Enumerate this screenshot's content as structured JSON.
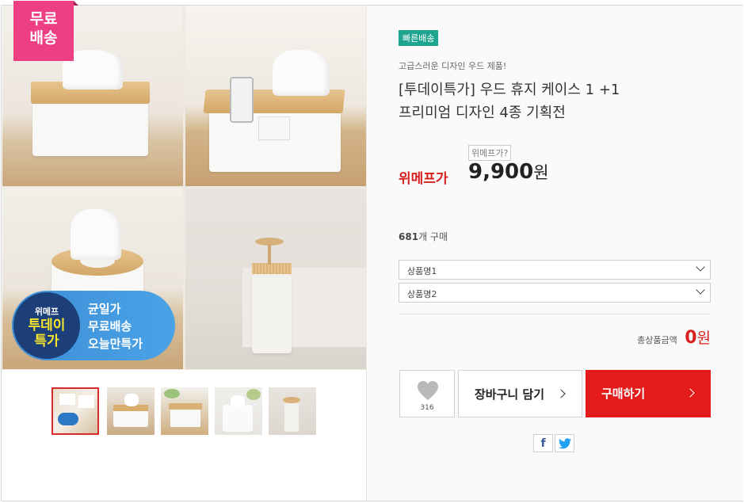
{
  "gallery": {
    "free_shipping_badge": [
      "무료",
      "배송"
    ],
    "promo": {
      "brand": "위메프",
      "title_lines": [
        "투데이",
        "특가"
      ],
      "lines": [
        "균일가",
        "무료배송",
        "오늘만특가"
      ]
    },
    "thumbnail_count": 5,
    "active_thumbnail": 1
  },
  "product": {
    "fast_badge": "빠른배송",
    "subtitle": "고급스러운 디자인 우드 제품!",
    "title_line1": "[투데이특가] 우드 휴지 케이스 1 +1",
    "title_line2": "프리미엄 디자인 4종 기획전",
    "price_question": "위메프가?",
    "price_label": "위메프가",
    "price": "9,900",
    "price_unit": "원",
    "sold_count": "681",
    "sold_suffix": "개 구매"
  },
  "options": {
    "select1": "상품명1",
    "select2": "상품명2"
  },
  "total": {
    "label": "총상품금액",
    "amount": "0",
    "unit": "원"
  },
  "actions": {
    "like_count": "316",
    "cart_label": "장바구니 담기",
    "buy_label": "구매하기"
  },
  "share": {
    "facebook_glyph": "f",
    "twitter_glyph": "t"
  },
  "colors": {
    "free_badge": "#ee3e84",
    "fast_badge": "#1fa58f",
    "accent_red": "#e41b1b",
    "price_red": "#d81f1f",
    "promo_blue": "#3e8ed6"
  }
}
